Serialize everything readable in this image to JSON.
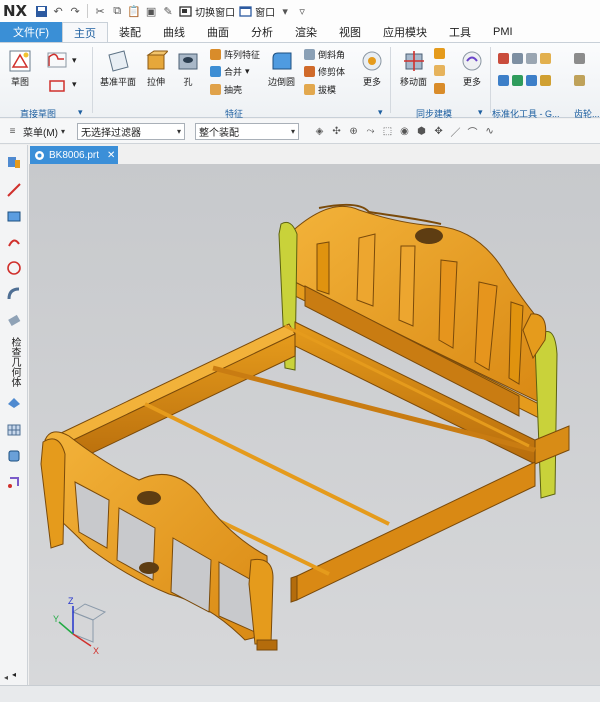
{
  "app": {
    "logo": "NX"
  },
  "quick_access": {
    "switch_window": "切换窗口",
    "window": "窗口"
  },
  "tabs": {
    "file": "文件(F)",
    "items": [
      "主页",
      "装配",
      "曲线",
      "曲面",
      "分析",
      "渲染",
      "视图",
      "应用模块",
      "工具",
      "PMI"
    ],
    "active": "主页"
  },
  "ribbon": {
    "sketch": "草图",
    "direct_sketch_group": "直接草图",
    "datum_plane": "基准平面",
    "extrude": "拉伸",
    "hole": "孔",
    "pattern_feature": "阵列特征",
    "unite": "合并",
    "shell": "抽壳",
    "edge_blend": "边倒圆",
    "chamfer": "倒斜角",
    "trim_body": "修剪体",
    "draft": "拔模",
    "more": "更多",
    "feature_group": "特征",
    "move_face": "移动面",
    "more2": "更多",
    "sync_group": "同步建模",
    "std_tools_group": "标准化工具 - G...",
    "gear_group": "齿轮..."
  },
  "command_bar": {
    "menu": "菜单(M)",
    "filter": "无选择过滤器",
    "scope": "整个装配"
  },
  "leftbar": {
    "vertical_text": "检查几何体"
  },
  "document": {
    "tab_label": "BK8006.prt"
  },
  "triad": {
    "x": "X",
    "y": "Y",
    "z": "Z"
  },
  "colors": {
    "accent": "#3a8fd6",
    "model_orange": "#e59b1c",
    "model_highlight": "#c9d23a"
  }
}
